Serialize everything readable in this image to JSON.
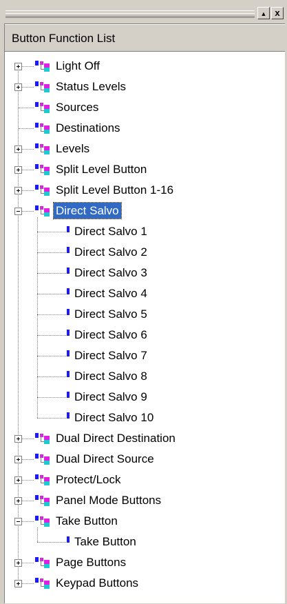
{
  "window": {
    "restore_glyph": "▲",
    "close_glyph": "x"
  },
  "panel": {
    "header_label": "Button Function List"
  },
  "tree": {
    "items": [
      {
        "label": "Light Off",
        "expander": "plus"
      },
      {
        "label": "Status Levels",
        "expander": "plus"
      },
      {
        "label": "Sources",
        "expander": "none"
      },
      {
        "label": "Destinations",
        "expander": "none"
      },
      {
        "label": "Levels",
        "expander": "plus"
      },
      {
        "label": "Split Level Button",
        "expander": "plus"
      },
      {
        "label": "Split Level Button 1-16",
        "expander": "plus"
      },
      {
        "label": "Direct Salvo",
        "expander": "minus",
        "selected": true,
        "children": [
          "Direct Salvo 1",
          "Direct Salvo 2",
          "Direct Salvo 3",
          "Direct Salvo 4",
          "Direct Salvo 5",
          "Direct Salvo 6",
          "Direct Salvo 7",
          "Direct Salvo 8",
          "Direct Salvo 9",
          "Direct Salvo 10"
        ]
      },
      {
        "label": "Dual Direct Destination",
        "expander": "plus"
      },
      {
        "label": "Dual Direct Source",
        "expander": "plus"
      },
      {
        "label": "Protect/Lock",
        "expander": "plus"
      },
      {
        "label": "Panel Mode Buttons",
        "expander": "plus"
      },
      {
        "label": "Take Button",
        "expander": "minus",
        "children": [
          "Take Button"
        ]
      },
      {
        "label": "Page Buttons",
        "expander": "plus"
      },
      {
        "label": "Keypad Buttons",
        "expander": "plus"
      }
    ]
  },
  "colors": {
    "selection": "#316ac5",
    "leaf_icon": "#1a1aff",
    "folder_magenta": "#e020e0",
    "folder_blue": "#1a1aff",
    "folder_cyan": "#20c8d0"
  }
}
